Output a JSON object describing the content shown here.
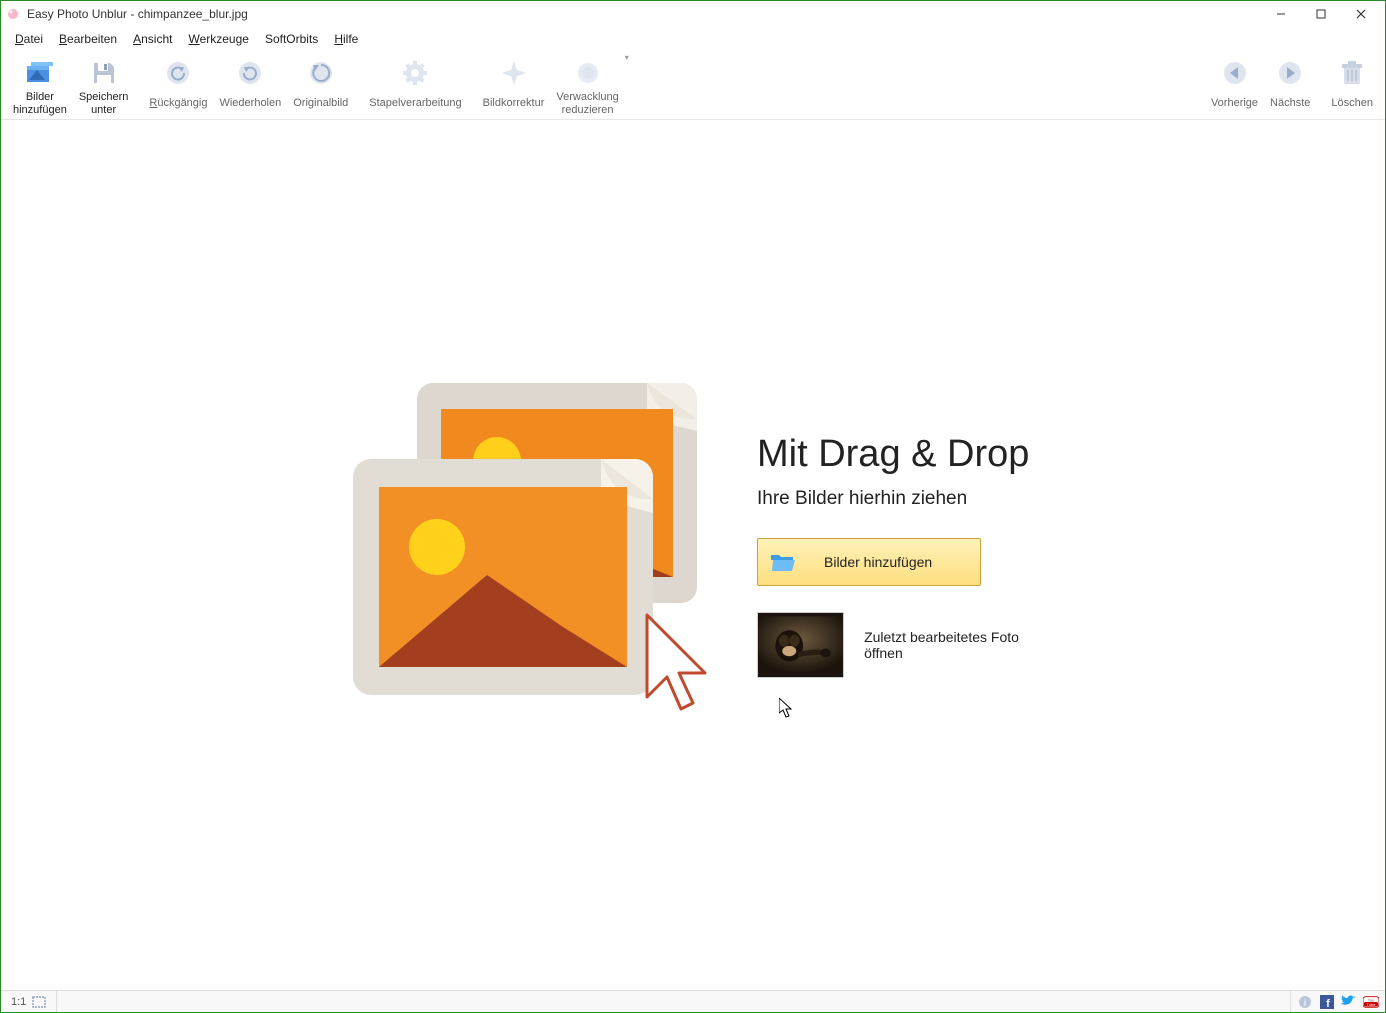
{
  "window": {
    "title": "Easy Photo Unblur - chimpanzee_blur.jpg"
  },
  "menu": [
    {
      "label": "Datei",
      "u": 0
    },
    {
      "label": "Bearbeiten",
      "u": 0
    },
    {
      "label": "Ansicht",
      "u": 0
    },
    {
      "label": "Werkzeuge",
      "u": 0
    },
    {
      "label": "SoftOrbits",
      "u": -1
    },
    {
      "label": "Hilfe",
      "u": 0
    }
  ],
  "toolbar": {
    "add_images": "Bilder\nhinzufügen",
    "save_as": "Speichern\nunter",
    "undo": "Rückgängig",
    "redo": "Wiederholen",
    "original": "Originalbild",
    "batch": "Stapelverarbeitung",
    "correction": "Bildkorrektur",
    "shake": "Verwacklung\nreduzieren",
    "prev": "Vorherige",
    "next": "Nächste",
    "delete": "Löschen"
  },
  "drop": {
    "heading": "Mit Drag & Drop",
    "sub": "Ihre Bilder hierhin ziehen",
    "button": "Bilder hinzufügen",
    "recent": "Zuletzt bearbeitetes Foto öffnen"
  },
  "status": {
    "zoom": "1:1"
  }
}
